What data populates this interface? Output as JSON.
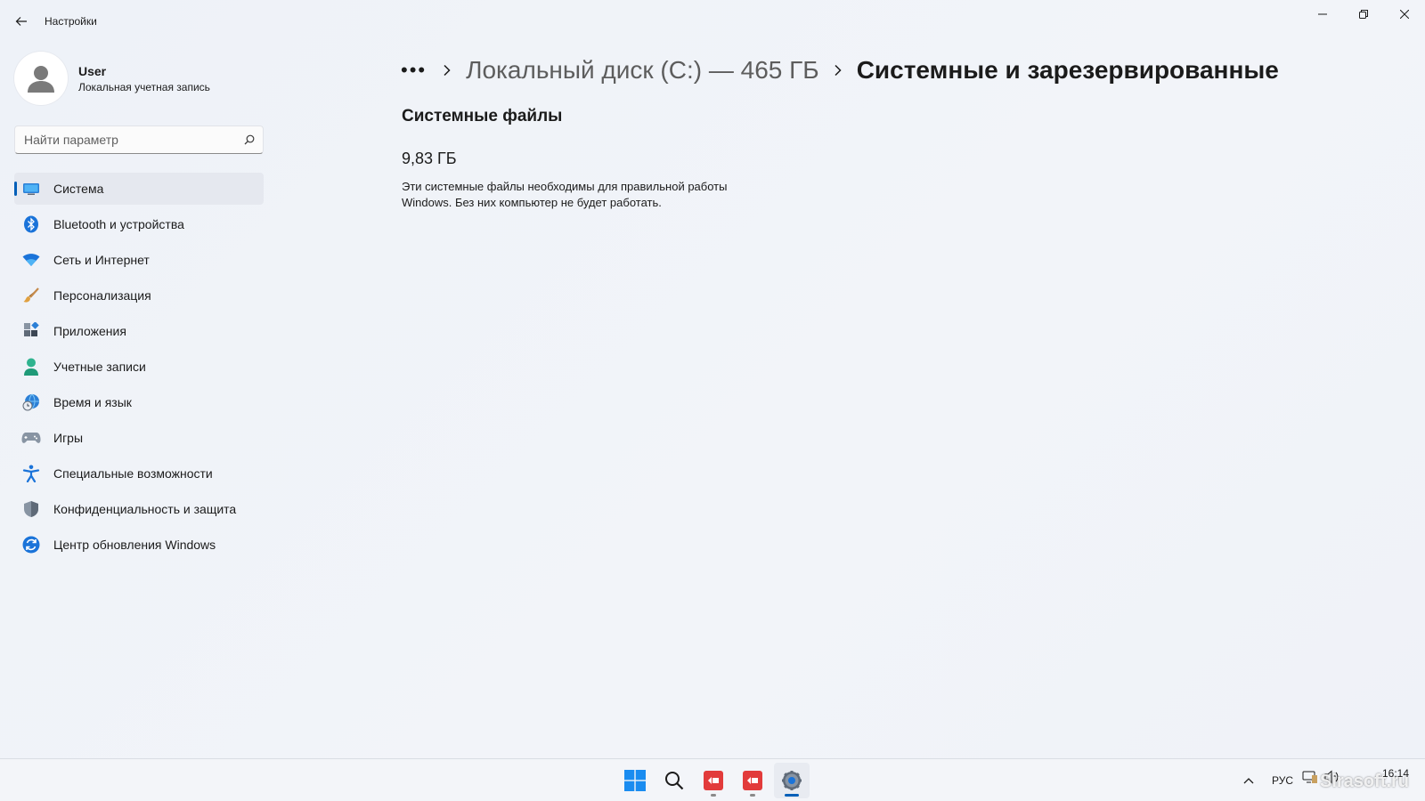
{
  "window": {
    "title": "Настройки"
  },
  "profile": {
    "name": "User",
    "account_type": "Локальная учетная запись"
  },
  "search": {
    "placeholder": "Найти параметр"
  },
  "sidebar": {
    "items": [
      {
        "label": "Система",
        "icon": "system-icon",
        "active": true
      },
      {
        "label": "Bluetooth и устройства",
        "icon": "bluetooth-icon"
      },
      {
        "label": "Сеть и Интернет",
        "icon": "wifi-icon"
      },
      {
        "label": "Персонализация",
        "icon": "brush-icon"
      },
      {
        "label": "Приложения",
        "icon": "apps-icon"
      },
      {
        "label": "Учетные записи",
        "icon": "accounts-icon"
      },
      {
        "label": "Время и язык",
        "icon": "globe-clock-icon"
      },
      {
        "label": "Игры",
        "icon": "gamepad-icon"
      },
      {
        "label": "Специальные возможности",
        "icon": "accessibility-icon"
      },
      {
        "label": "Конфиденциальность и защита",
        "icon": "shield-icon"
      },
      {
        "label": "Центр обновления Windows",
        "icon": "update-icon"
      }
    ]
  },
  "breadcrumb": {
    "more": "•••",
    "parent": "Локальный диск (C:) — 465 ГБ",
    "current": "Системные и зарезервированные"
  },
  "content": {
    "section_title": "Системные файлы",
    "size": "9,83 ГБ",
    "description": "Эти системные файлы необходимы для правильной работы Windows. Без них компьютер не будет работать."
  },
  "taskbar": {
    "apps": [
      "start-icon",
      "search-icon",
      "app-red-icon",
      "app-red-icon-2",
      "settings-icon"
    ],
    "language": "РУС",
    "time": "16:14",
    "watermark": "Sirasoft.ru"
  },
  "colors": {
    "accent": "#005fb8",
    "background": "#eef2f8"
  }
}
